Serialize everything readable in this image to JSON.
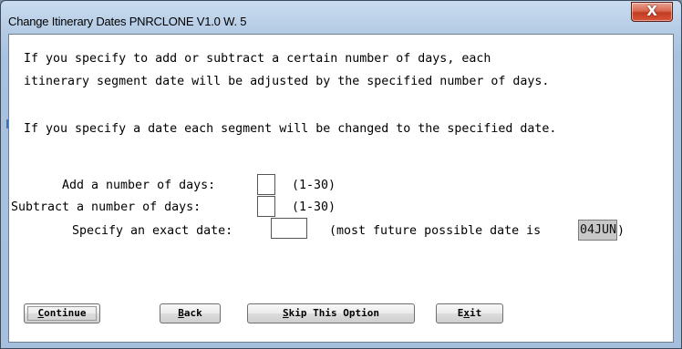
{
  "window": {
    "title": "Change Itinerary Dates   PNRCLONE V1.0 W. 5",
    "close_glyph": "X"
  },
  "body": {
    "line1": "If you specify to add or subtract a certain number of days, each",
    "line2": "itinerary segment date will be adjusted by the specified number of days.",
    "line3": "If you specify a date each segment will be changed to the specified date."
  },
  "form": {
    "add_label": "Add a number of days:",
    "add_value": "",
    "add_range": "(1-30)",
    "subtract_label": "Subtract a number of days:",
    "subtract_value": "",
    "subtract_range": "(1-30)",
    "date_label": "Specify an exact date:",
    "date_value": "",
    "date_note_prefix": "(most future possible date is ",
    "max_date": "04JUN",
    "date_note_suffix": ")"
  },
  "buttons": {
    "continue": {
      "first": "C",
      "rest": "ontinue"
    },
    "back": {
      "first": "B",
      "rest": "ack"
    },
    "skip": {
      "first": "S",
      "rest": "kip This Option"
    },
    "exit": {
      "pre": "E",
      "u": "x",
      "post": "it"
    }
  }
}
